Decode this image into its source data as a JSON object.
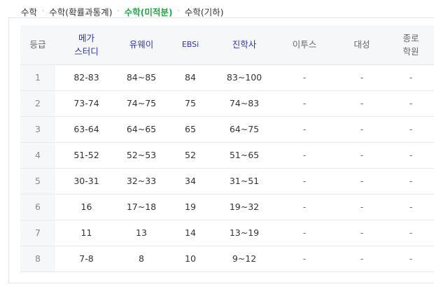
{
  "tabs": [
    {
      "label": "수학",
      "active": false
    },
    {
      "label": "수학(확률과통계)",
      "active": false
    },
    {
      "label": "수학(미적분)",
      "active": true
    },
    {
      "label": "수학(기하)",
      "active": false
    }
  ],
  "separator": "·",
  "table": {
    "headers": {
      "grade": "등급",
      "mega_line1": "메가",
      "mega_line2": "스터디",
      "uway": "유웨이",
      "ebsi": "EBSi",
      "jinhaksa": "진학사",
      "etoos": "이투스",
      "daesung": "대성",
      "jongro_line1": "종로",
      "jongro_line2": "학원"
    },
    "rows": [
      [
        "1",
        "82-83",
        "84~85",
        "84",
        "83~100",
        "-",
        "-",
        "-"
      ],
      [
        "2",
        "73-74",
        "74~75",
        "75",
        "74~83",
        "-",
        "-",
        "-"
      ],
      [
        "3",
        "63-64",
        "64~65",
        "65",
        "64~75",
        "-",
        "-",
        "-"
      ],
      [
        "4",
        "51-52",
        "52~53",
        "52",
        "51~65",
        "-",
        "-",
        "-"
      ],
      [
        "5",
        "30-31",
        "32~33",
        "34",
        "31~51",
        "-",
        "-",
        "-"
      ],
      [
        "6",
        "16",
        "17~18",
        "19",
        "19~32",
        "-",
        "-",
        "-"
      ],
      [
        "7",
        "11",
        "13",
        "14",
        "13~19",
        "-",
        "-",
        "-"
      ],
      [
        "8",
        "7-8",
        "8",
        "10",
        "9~12",
        "-",
        "-",
        "-"
      ]
    ]
  },
  "colors": {
    "active_tab": "#27a54a",
    "highlight_header": "#3033a8",
    "header_bg": "#f6f7f9"
  }
}
